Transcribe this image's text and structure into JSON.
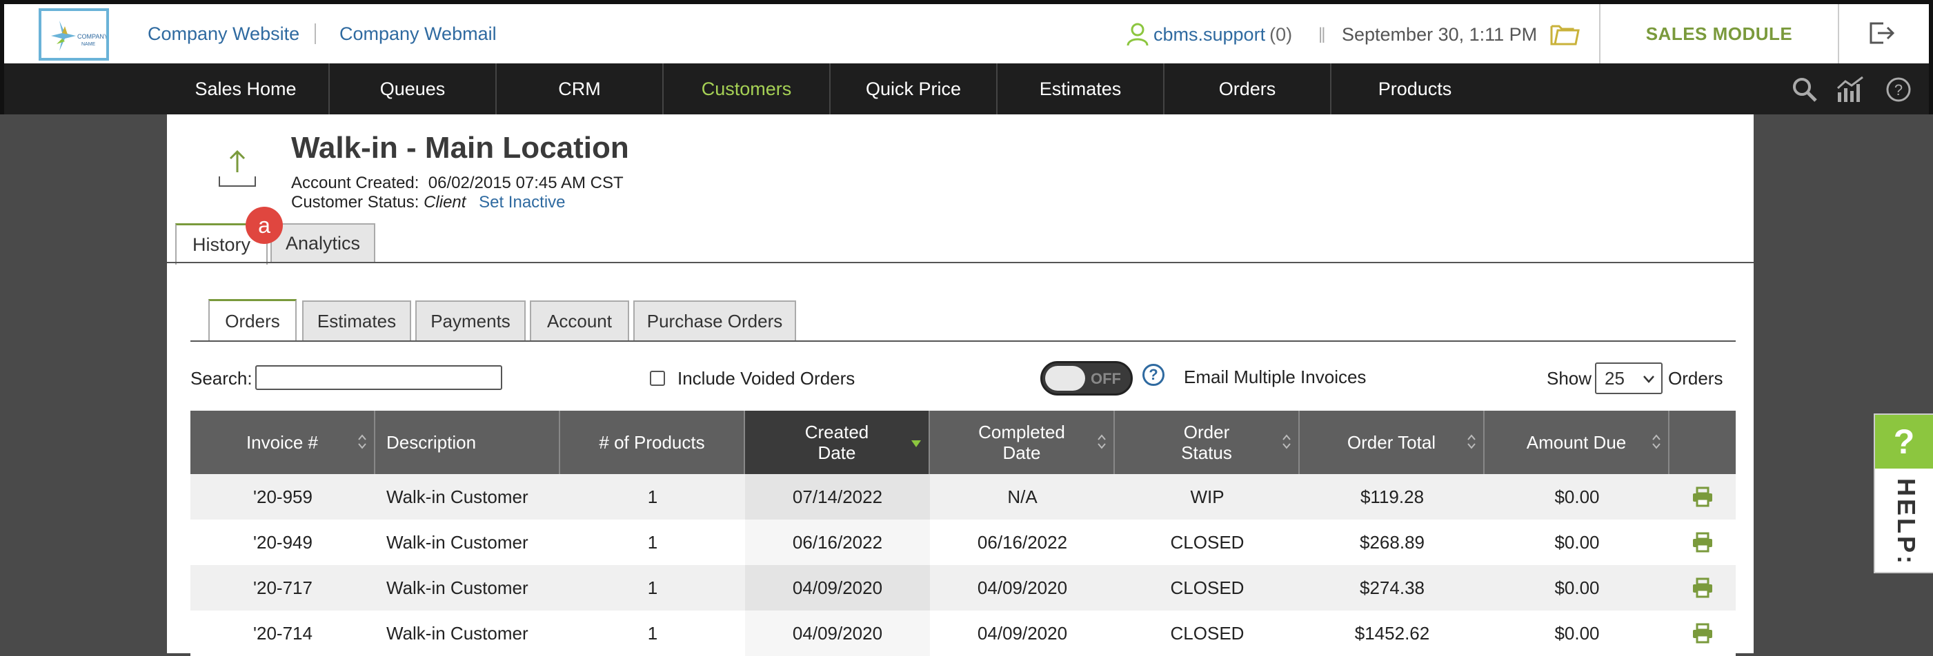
{
  "header": {
    "logo_text": "COMPANY NAME",
    "links": [
      "Company Website",
      "Company Webmail"
    ],
    "user": "cbms.support",
    "user_count": "(0)",
    "datetime": "September 30, 1:11 PM",
    "module": "SALES MODULE"
  },
  "nav": {
    "items": [
      "Sales Home",
      "Queues",
      "CRM",
      "Customers",
      "Quick Price",
      "Estimates",
      "Orders",
      "Products"
    ],
    "active": "Customers"
  },
  "customer": {
    "title": "Walk-in - Main Location",
    "account_created_label": "Account Created:",
    "account_created": "06/02/2015 07:45 AM CST",
    "status_label": "Customer Status:",
    "status": "Client",
    "set_inactive": "Set Inactive"
  },
  "main_tabs": [
    "History",
    "Analytics"
  ],
  "badge": "a",
  "sub_tabs": [
    "Orders",
    "Estimates",
    "Payments",
    "Account",
    "Purchase Orders"
  ],
  "filters": {
    "search_label": "Search:",
    "include_voided": "Include Voided Orders",
    "toggle_state": "OFF",
    "help": "?",
    "email_multiple": "Email Multiple Invoices",
    "show_label": "Show",
    "show_value": "25",
    "orders_label": "Orders"
  },
  "table": {
    "columns": [
      "Invoice #",
      "Description",
      "# of Products",
      "Created Date",
      "Completed Date",
      "Order Status",
      "Order Total",
      "Amount Due",
      ""
    ],
    "rows": [
      [
        "'20-959",
        "Walk-in Customer",
        "1",
        "07/14/2022",
        "N/A",
        "WIP",
        "$119.28",
        "$0.00"
      ],
      [
        "'20-949",
        "Walk-in Customer",
        "1",
        "06/16/2022",
        "06/16/2022",
        "CLOSED",
        "$268.89",
        "$0.00"
      ],
      [
        "'20-717",
        "Walk-in Customer",
        "1",
        "04/09/2020",
        "04/09/2020",
        "CLOSED",
        "$274.38",
        "$0.00"
      ],
      [
        "'20-714",
        "Walk-in Customer",
        "1",
        "04/09/2020",
        "04/09/2020",
        "CLOSED",
        "$1452.62",
        "$0.00"
      ]
    ]
  },
  "help_tab": {
    "icon": "?",
    "label": "HELP:"
  },
  "colors": {
    "accent_green": "#a6d155",
    "link_blue": "#2f6aa0",
    "badge_red": "#e0463f"
  }
}
